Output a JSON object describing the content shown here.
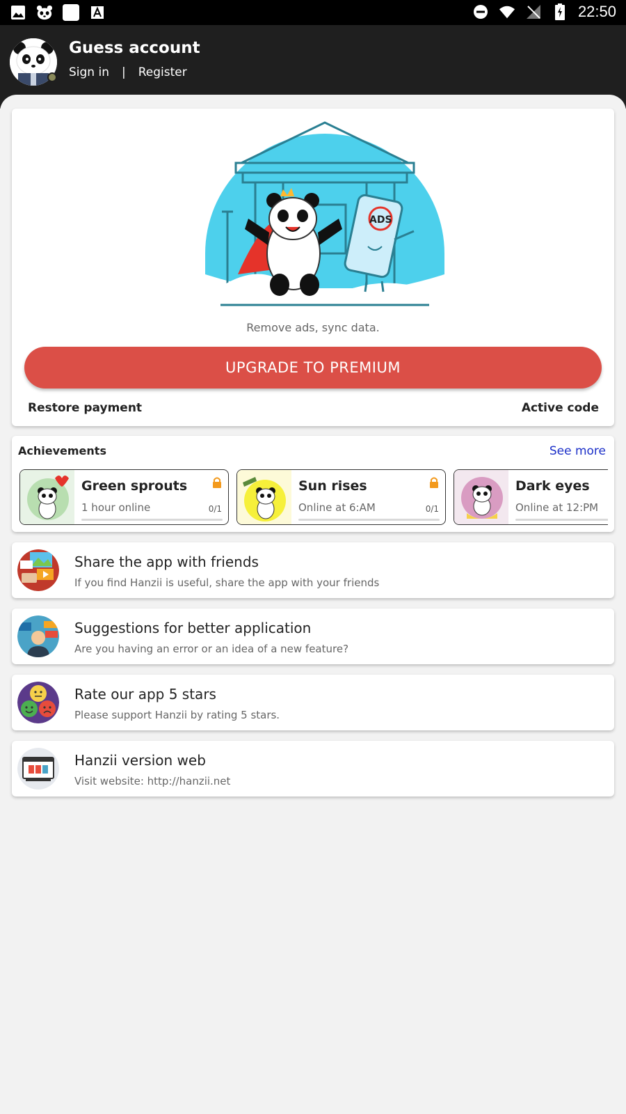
{
  "status_bar": {
    "time": "22:50",
    "left_icons": [
      "image-icon",
      "panda-icon",
      "blank-square-icon",
      "font-icon"
    ],
    "right_icons": [
      "do-not-disturb-icon",
      "wifi-icon",
      "no-signal-icon",
      "battery-charging-icon"
    ]
  },
  "header": {
    "account_title": "Guess account",
    "sign_in": "Sign in",
    "separator": "|",
    "register": "Register",
    "background": "#1f1f1f"
  },
  "promo": {
    "caption": "Remove ads, sync data.",
    "upgrade_label": "UPGRADE TO PREMIUM",
    "restore_label": "Restore payment",
    "active_code_label": "Active code",
    "illustration_text": "ADS",
    "accent": "#db4f47",
    "illustration_bg": "#4dd0ec"
  },
  "achievements": {
    "title": "Achievements",
    "see_more": "See more",
    "link_color": "#1b2fc8",
    "items": [
      {
        "name": "Green sprouts",
        "desc": "1 hour online",
        "count": "0/1",
        "locked": true,
        "thumb_bg": "#e8f3e6"
      },
      {
        "name": "Sun rises",
        "desc": "Online at 6:AM",
        "count": "0/1",
        "locked": true,
        "thumb_bg": "#fdfad8"
      },
      {
        "name": "Dark eyes",
        "desc": "Online at 12:PM",
        "count": "",
        "locked": false,
        "thumb_bg": "#f3e8ef"
      }
    ]
  },
  "menu": [
    {
      "title": "Share the app with friends",
      "subtitle": "If you find Hanzii is useful, share the app with your friends",
      "icon": "share-icon"
    },
    {
      "title": "Suggestions for better application",
      "subtitle": "Are you having an error or an idea of a new feature?",
      "icon": "feedback-icon"
    },
    {
      "title": "Rate our app 5 stars",
      "subtitle": "Please support Hanzii by rating 5 stars.",
      "icon": "rating-faces-icon"
    },
    {
      "title": "Hanzii version web",
      "subtitle": "Visit website: http://hanzii.net",
      "icon": "browser-icon"
    }
  ]
}
